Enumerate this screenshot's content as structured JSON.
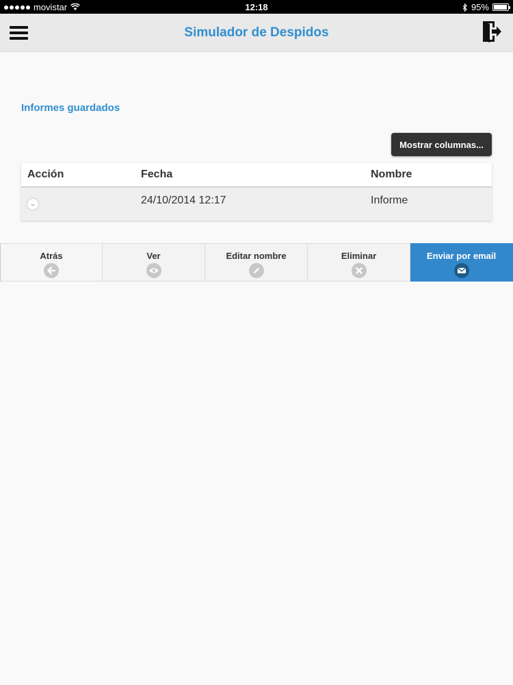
{
  "status_bar": {
    "carrier": "movistar",
    "time": "12:18",
    "battery": "95%",
    "battery_level": 0.95
  },
  "header": {
    "title": "Simulador de Despidos",
    "menu_icon": "hamburger-menu-icon",
    "logout_icon": "exit-door-icon"
  },
  "main": {
    "section_title": "Informes guardados",
    "columns_button": "Mostrar columnas...",
    "table": {
      "headers": [
        "Acción",
        "Fecha",
        "Nombre"
      ],
      "rows": [
        {
          "fecha": "24/10/2014 12:17",
          "nombre": "Informe"
        }
      ]
    }
  },
  "toolbar": {
    "buttons": [
      {
        "label": "Atrás",
        "icon": "arrow-left-icon"
      },
      {
        "label": "Ver",
        "icon": "eye-icon"
      },
      {
        "label": "Editar nombre",
        "icon": "pencil-icon"
      },
      {
        "label": "Eliminar",
        "icon": "close-icon"
      },
      {
        "label": "Enviar por email",
        "icon": "mail-icon"
      }
    ]
  },
  "colors": {
    "accent": "#2f8fcf",
    "primary_button": "#3388cc",
    "dark_button": "#333333"
  }
}
